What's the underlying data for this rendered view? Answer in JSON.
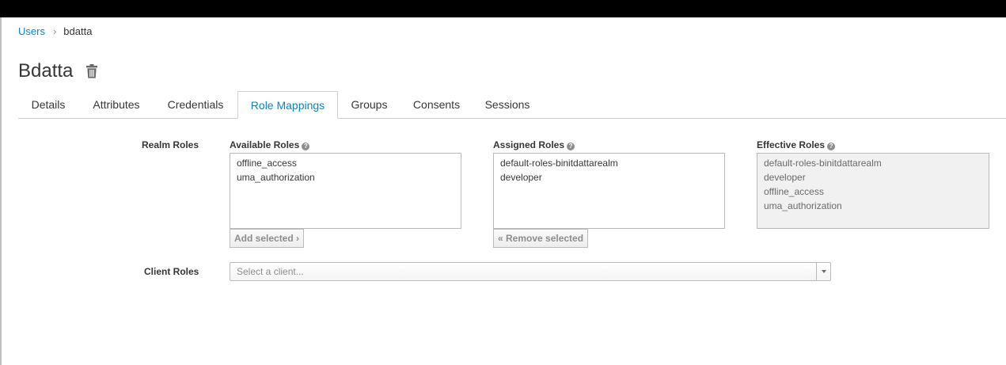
{
  "breadcrumb": {
    "parent": "Users",
    "separator": "›",
    "current": "bdatta"
  },
  "page": {
    "title": "Bdatta",
    "delete_icon": "trash-icon"
  },
  "tabs": [
    {
      "label": "Details"
    },
    {
      "label": "Attributes"
    },
    {
      "label": "Credentials"
    },
    {
      "label": "Role Mappings",
      "active": true
    },
    {
      "label": "Groups"
    },
    {
      "label": "Consents"
    },
    {
      "label": "Sessions"
    }
  ],
  "realm_roles": {
    "label": "Realm Roles",
    "available": {
      "label": "Available Roles",
      "items": [
        "offline_access",
        "uma_authorization"
      ],
      "button": "Add selected ›"
    },
    "assigned": {
      "label": "Assigned Roles",
      "items": [
        "default-roles-binitdattarealm",
        "developer"
      ],
      "button": "« Remove selected"
    },
    "effective": {
      "label": "Effective Roles",
      "items": [
        "default-roles-binitdattarealm",
        "developer",
        "offline_access",
        "uma_authorization"
      ]
    }
  },
  "client_roles": {
    "label": "Client Roles",
    "placeholder": "Select a client..."
  },
  "colors": {
    "link": "#0088ce",
    "text": "#363636",
    "topbar": "#000000"
  }
}
